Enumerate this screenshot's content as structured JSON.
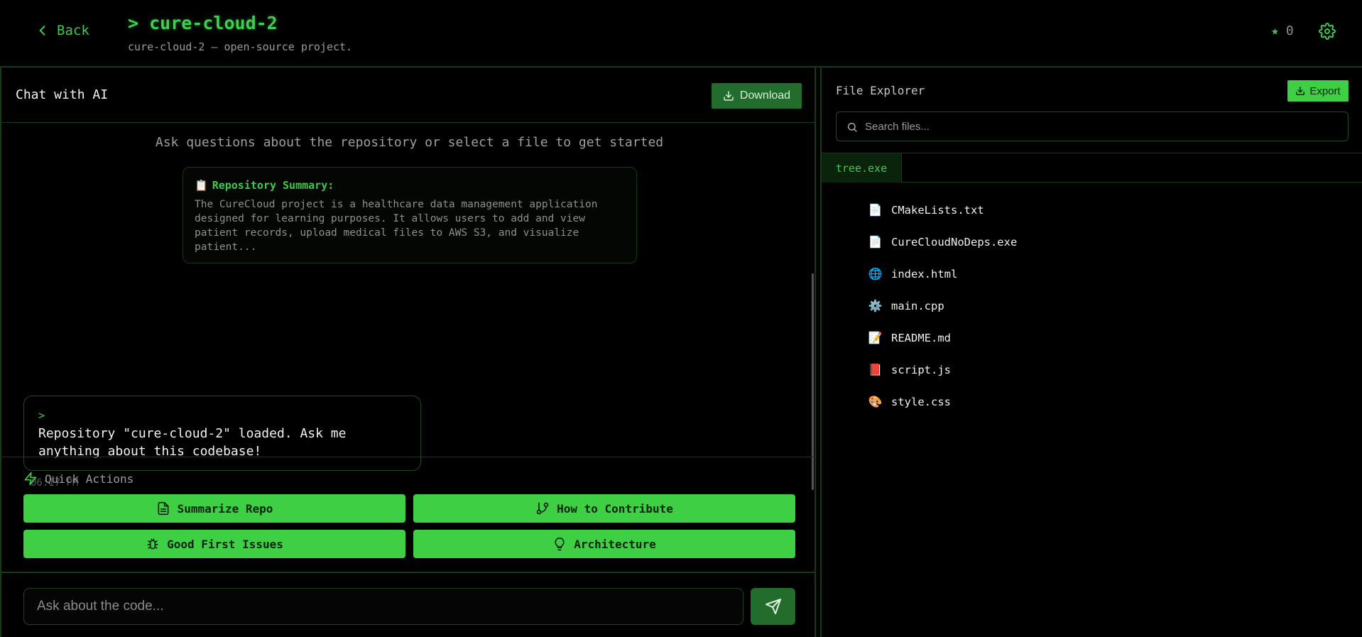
{
  "header": {
    "back_label": "Back",
    "title": "> cure-cloud-2",
    "subtitle": "cure-cloud-2 — open-source project.",
    "star_count": "0"
  },
  "chat": {
    "title": "Chat with AI",
    "download_label": "Download",
    "hint": "Ask questions about the repository or select a file to get started",
    "summary": {
      "icon": "📋",
      "title": "Repository Summary:",
      "text": "The CureCloud project is a healthcare data management application designed for learning purposes. It allows users to add and view patient records, upload medical files to AWS S3, and visualize patient..."
    },
    "message": {
      "prompt": ">",
      "text": "Repository \"cure-cloud-2\" loaded. Ask me anything about this codebase!",
      "time": "06:17 PM"
    }
  },
  "quick_actions": {
    "title": "Quick Actions",
    "items": [
      {
        "label": "Summarize Repo",
        "icon": "document-icon"
      },
      {
        "label": "How to Contribute",
        "icon": "git-branch-icon"
      },
      {
        "label": "Good First Issues",
        "icon": "bug-icon"
      },
      {
        "label": "Architecture",
        "icon": "lightbulb-icon"
      }
    ]
  },
  "input": {
    "placeholder": "Ask about the code..."
  },
  "explorer": {
    "title": "File Explorer",
    "export_label": "Export",
    "search_placeholder": "Search files...",
    "tab_label": "tree.exe",
    "files": [
      {
        "name": "CMakeLists.txt",
        "icon": "📄"
      },
      {
        "name": "CureCloudNoDeps.exe",
        "icon": "📄"
      },
      {
        "name": "index.html",
        "icon": "🌐"
      },
      {
        "name": "main.cpp",
        "icon": "⚙️"
      },
      {
        "name": "README.md",
        "icon": "📝"
      },
      {
        "name": "script.js",
        "icon": "📕"
      },
      {
        "name": "style.css",
        "icon": "🎨"
      }
    ]
  },
  "colors": {
    "accent": "#3ecf44",
    "accent_dark": "#226d2b",
    "border": "#123d14",
    "background": "#000000"
  }
}
